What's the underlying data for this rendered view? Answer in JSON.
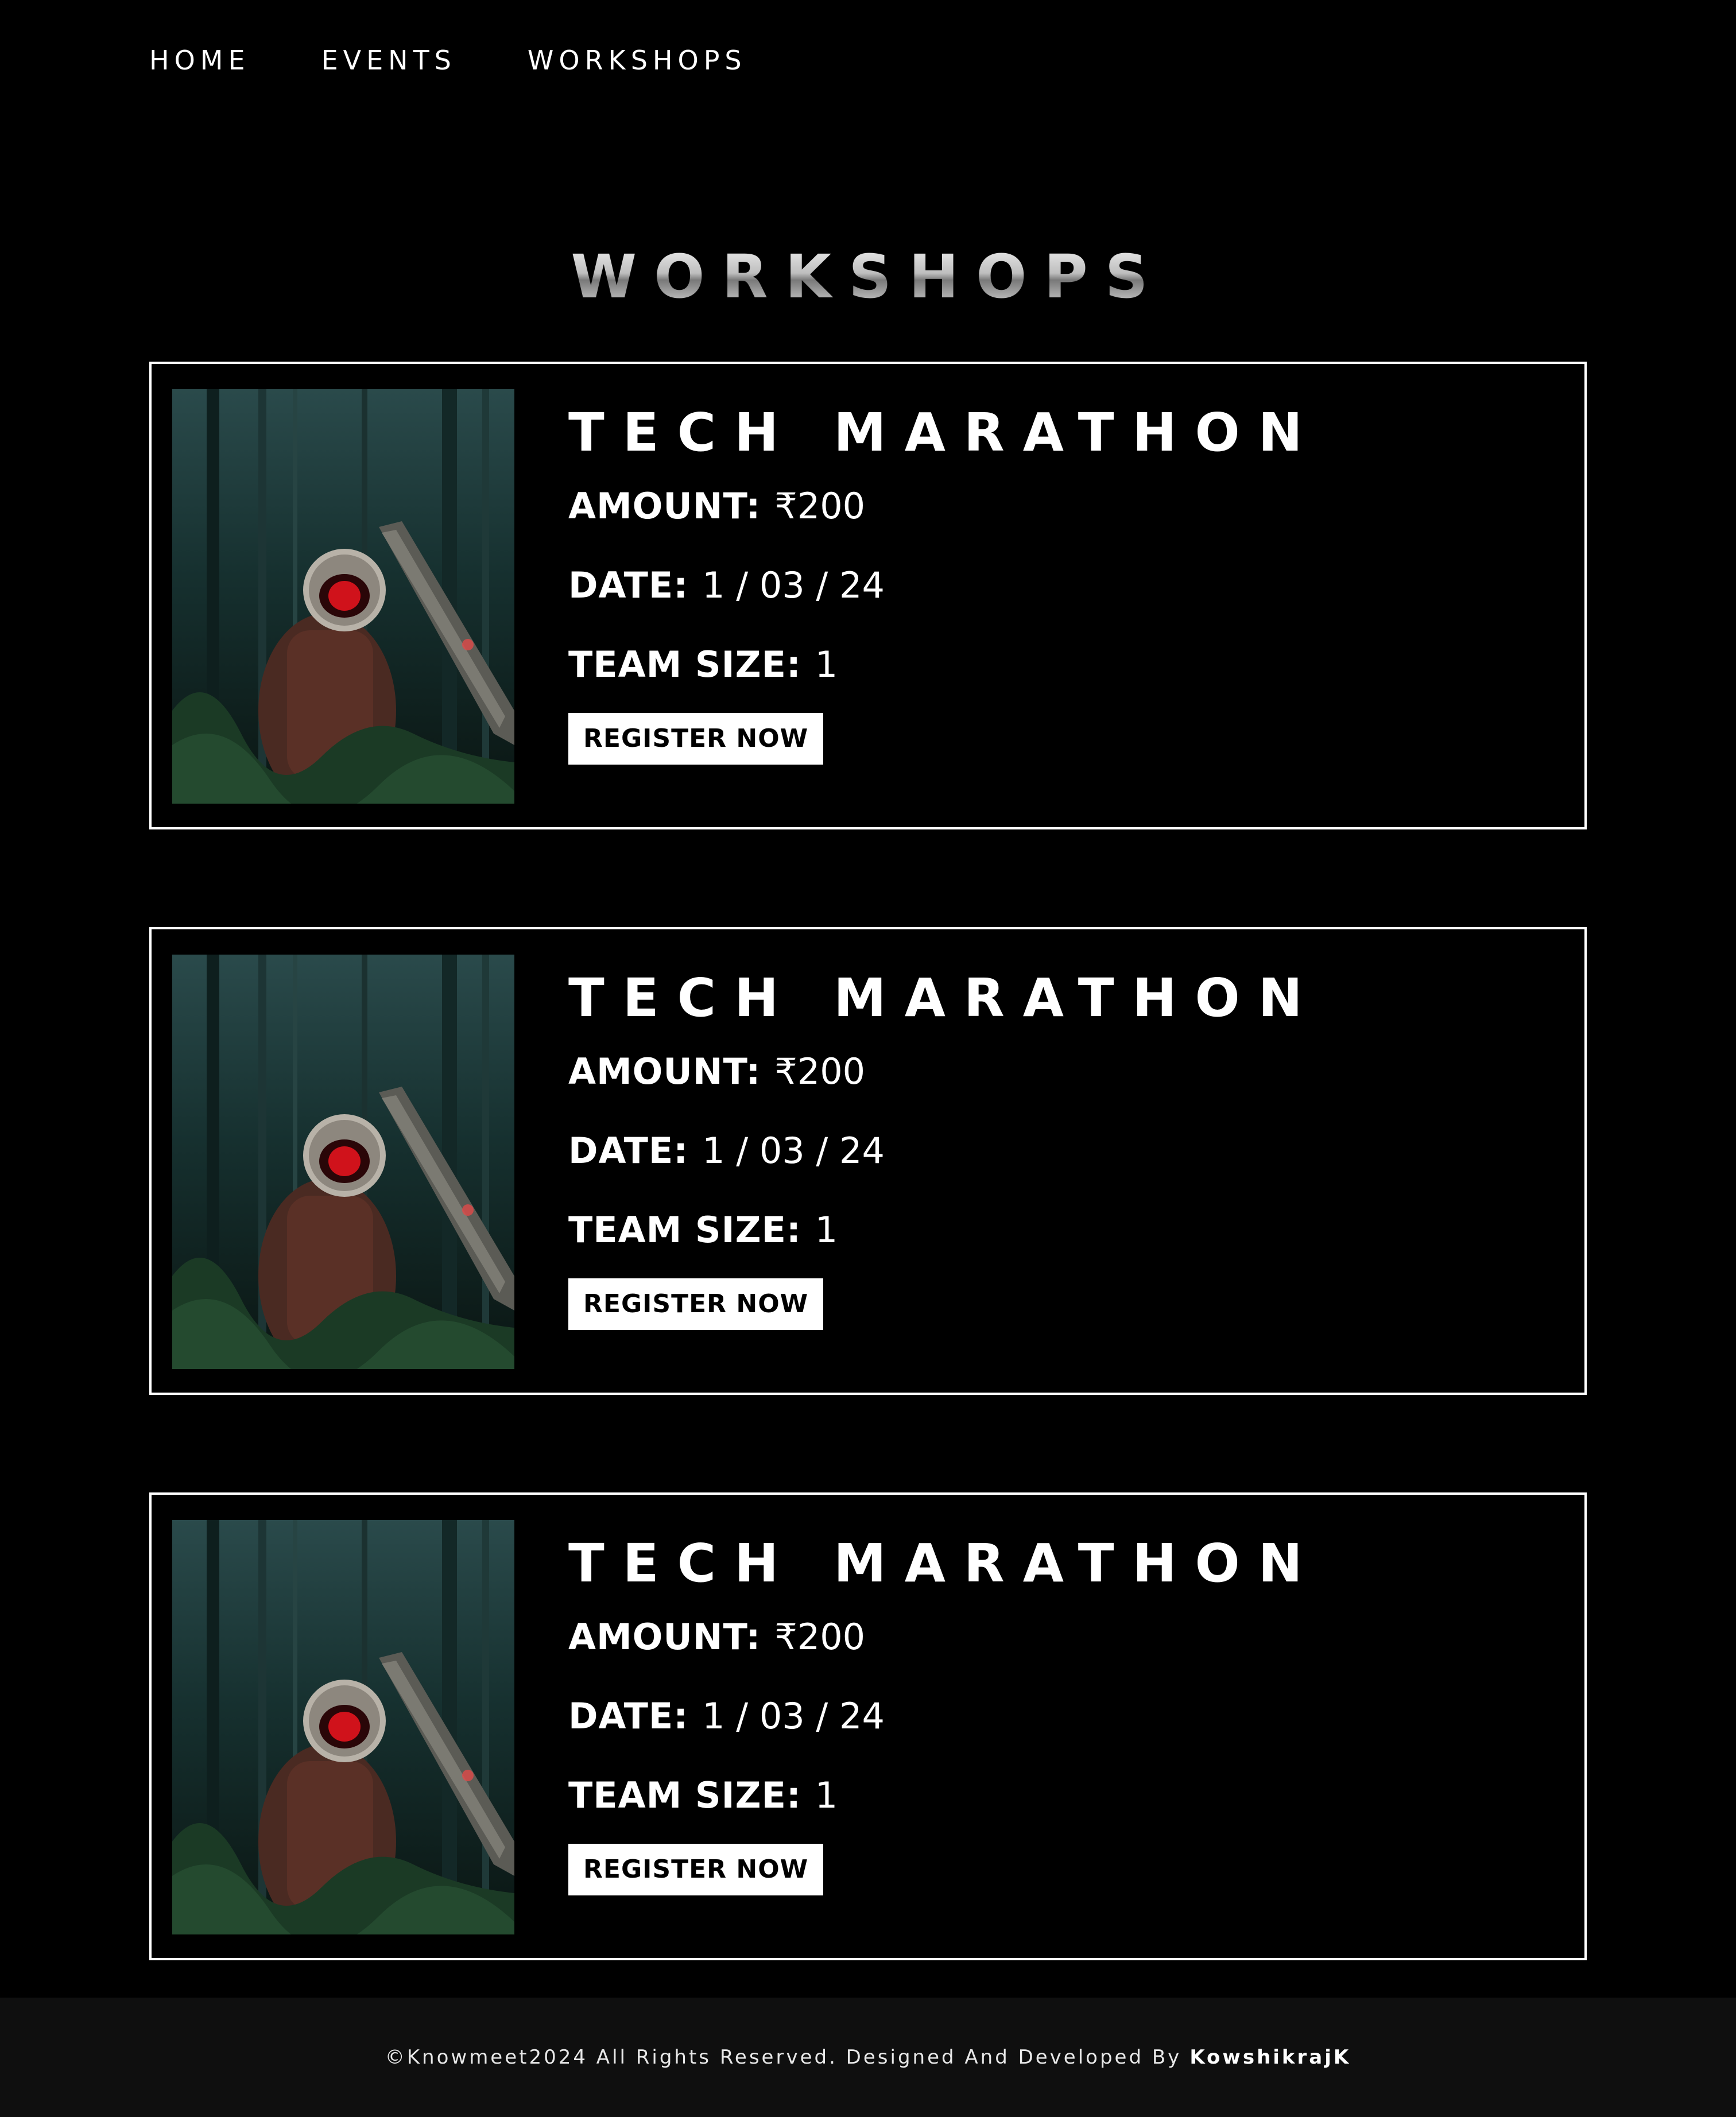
{
  "nav": {
    "items": [
      {
        "label": "HOME"
      },
      {
        "label": "EVENTS"
      },
      {
        "label": "WORKSHOPS"
      }
    ]
  },
  "page": {
    "title": "WORKSHOPS"
  },
  "cards": [
    {
      "title": "TECH MARATHON",
      "amount_label": "AMOUNT:",
      "amount_value": "₹200",
      "date_label": "DATE:",
      "date_value": "1 / 03 / 24",
      "team_label": "TEAM SIZE:",
      "team_value": "1",
      "button_label": "REGISTER NOW",
      "image": "astronaut-in-forest-image"
    },
    {
      "title": "TECH MARATHON",
      "amount_label": "AMOUNT:",
      "amount_value": "₹200",
      "date_label": "DATE:",
      "date_value": "1 / 03 / 24",
      "team_label": "TEAM SIZE:",
      "team_value": "1",
      "button_label": "REGISTER NOW",
      "image": "astronaut-in-forest-image"
    },
    {
      "title": "TECH MARATHON",
      "amount_label": "AMOUNT:",
      "amount_value": "₹200",
      "date_label": "DATE:",
      "date_value": "1 / 03 / 24",
      "team_label": "TEAM SIZE:",
      "team_value": "1",
      "button_label": "REGISTER NOW",
      "image": "astronaut-in-forest-image"
    }
  ],
  "footer": {
    "text": "©Knowmeet2024 All Rights Reserved. Designed And Developed By",
    "author": "KowshikrajK"
  },
  "colors": {
    "background": "#000000",
    "text": "#ffffff",
    "footer_background": "#0f0f0f",
    "button_background": "#ffffff",
    "button_text": "#000000",
    "visor_accent": "#d0121b"
  }
}
